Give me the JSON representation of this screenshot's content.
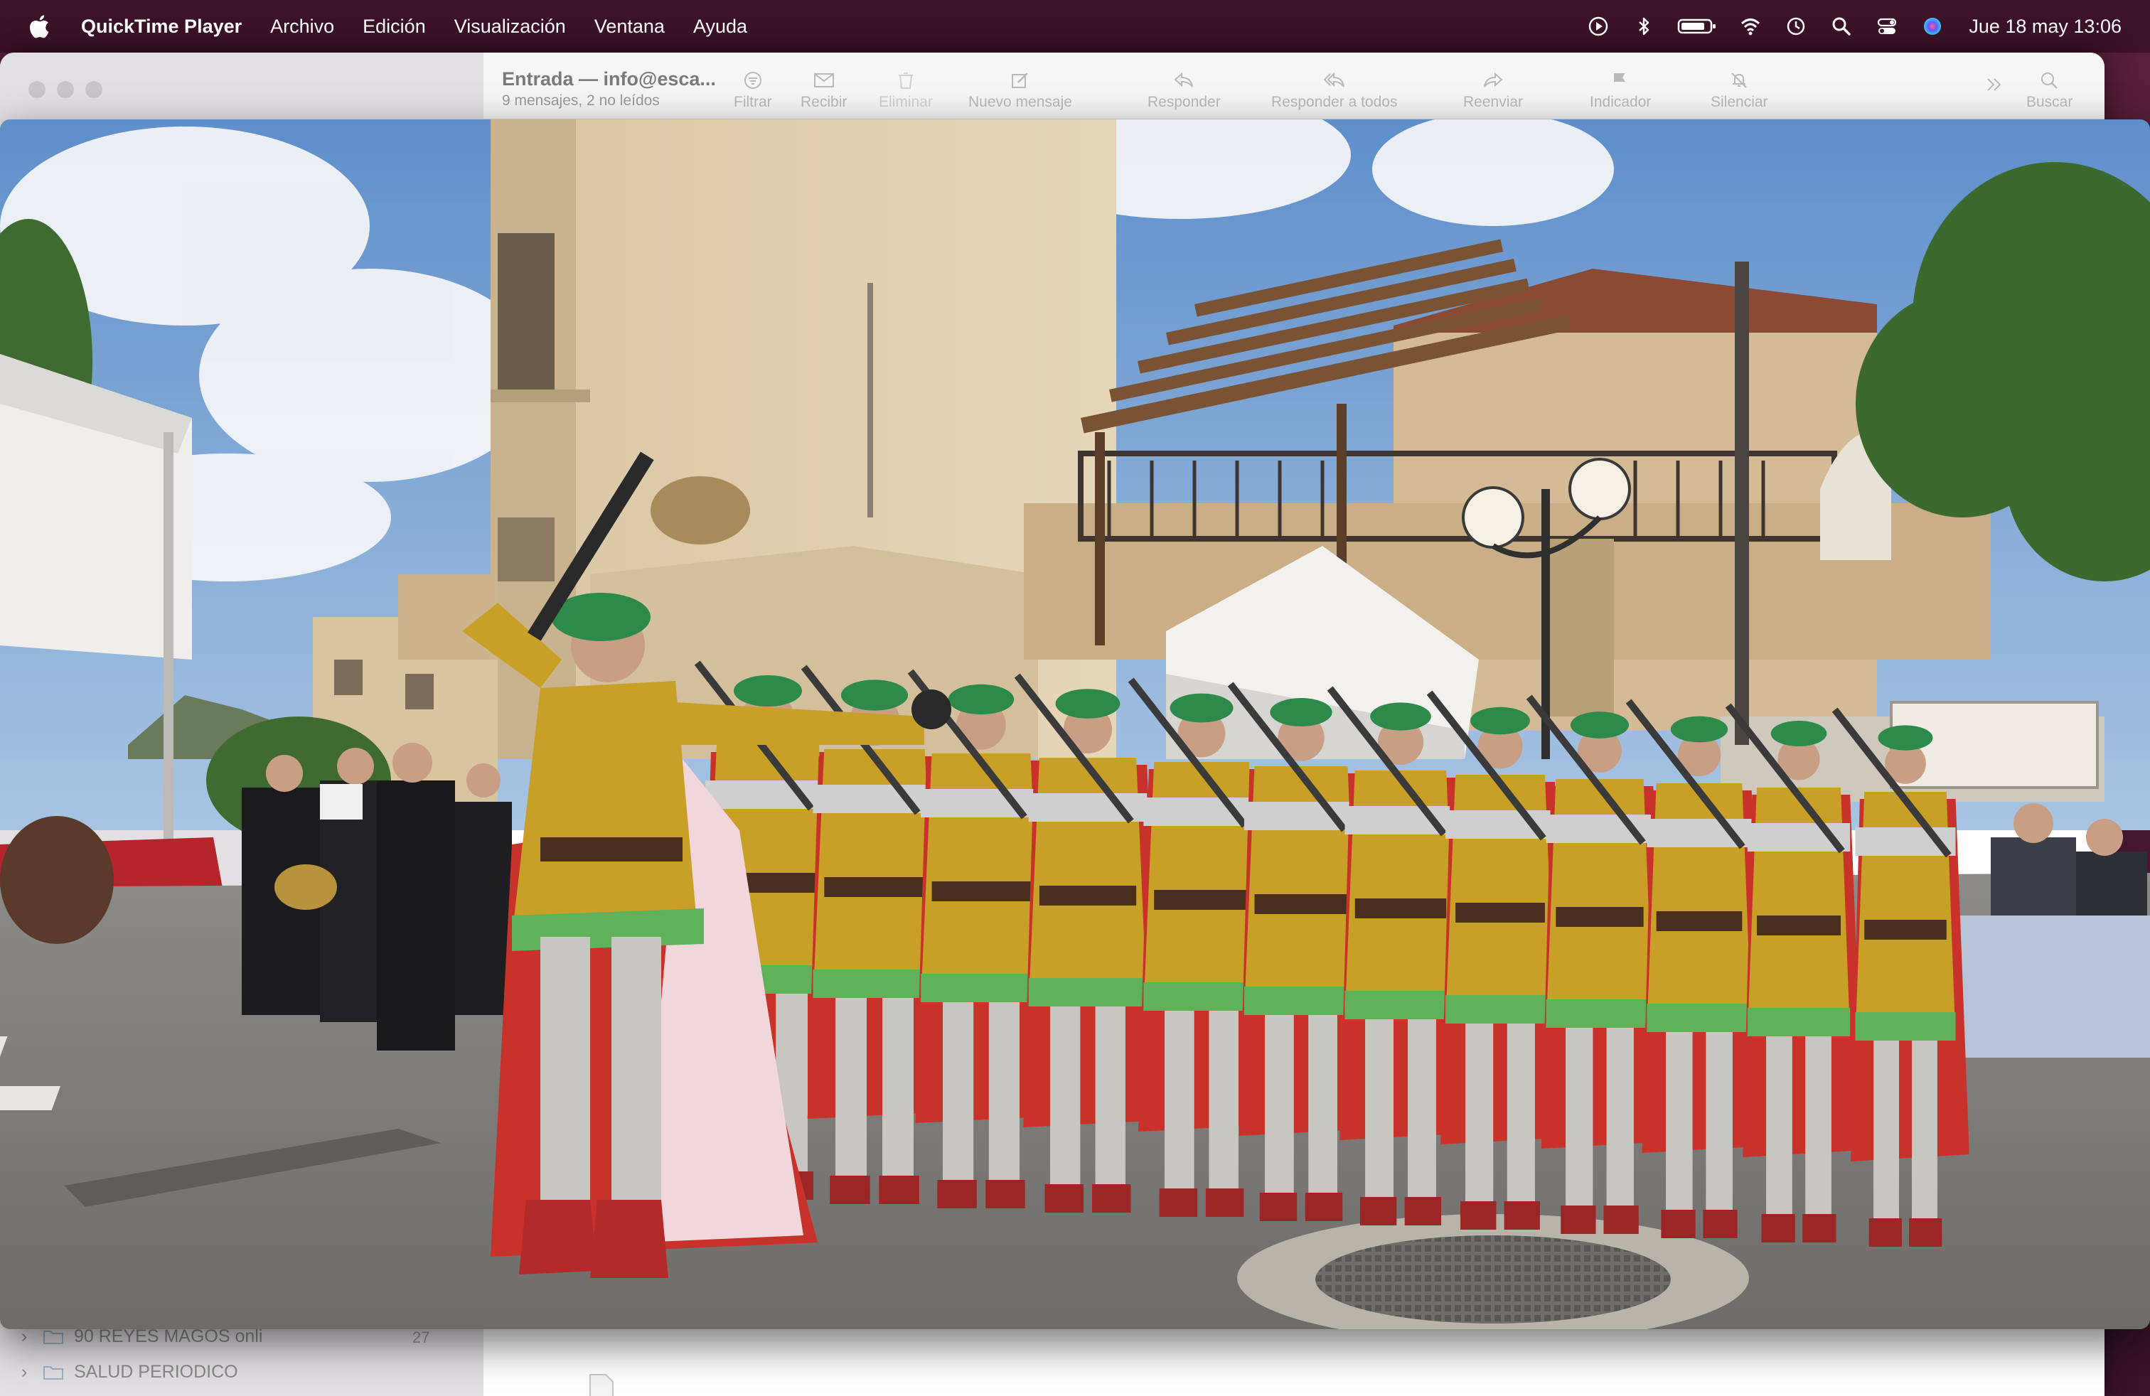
{
  "menubar": {
    "app_name": "QuickTime Player",
    "menus": [
      "Archivo",
      "Edición",
      "Visualización",
      "Ventana",
      "Ayuda"
    ],
    "clock": "Jue 18 may  13:06",
    "status_icons": [
      "play-circle-icon",
      "bluetooth-icon",
      "battery-icon",
      "wifi-icon",
      "time-machine-icon",
      "spotlight-icon",
      "control-center-icon",
      "siri-icon"
    ]
  },
  "mail": {
    "mailbox_title": "Entrada — info@esca...",
    "mailbox_subtitle": "9 mensajes, 2 no leídos",
    "toolbar": {
      "filter": "Filtrar",
      "receive": "Recibir",
      "delete": "Eliminar",
      "new_message": "Nuevo mensaje",
      "reply": "Responder",
      "reply_all": "Responder a todos",
      "forward": "Reenviar",
      "flag": "Indicador",
      "mute": "Silenciar",
      "search": "Buscar"
    },
    "folders": [
      {
        "name": "90 REYES MAGOS onli",
        "count": "27"
      },
      {
        "name": "SALUD PERIODICO",
        "count": ""
      }
    ]
  },
  "video": {
    "sky_color": "#7fa8d8",
    "costume_colors": {
      "tunic": "#c8a028",
      "hat": "#2e8a4a",
      "cape": "#c8322a"
    }
  }
}
